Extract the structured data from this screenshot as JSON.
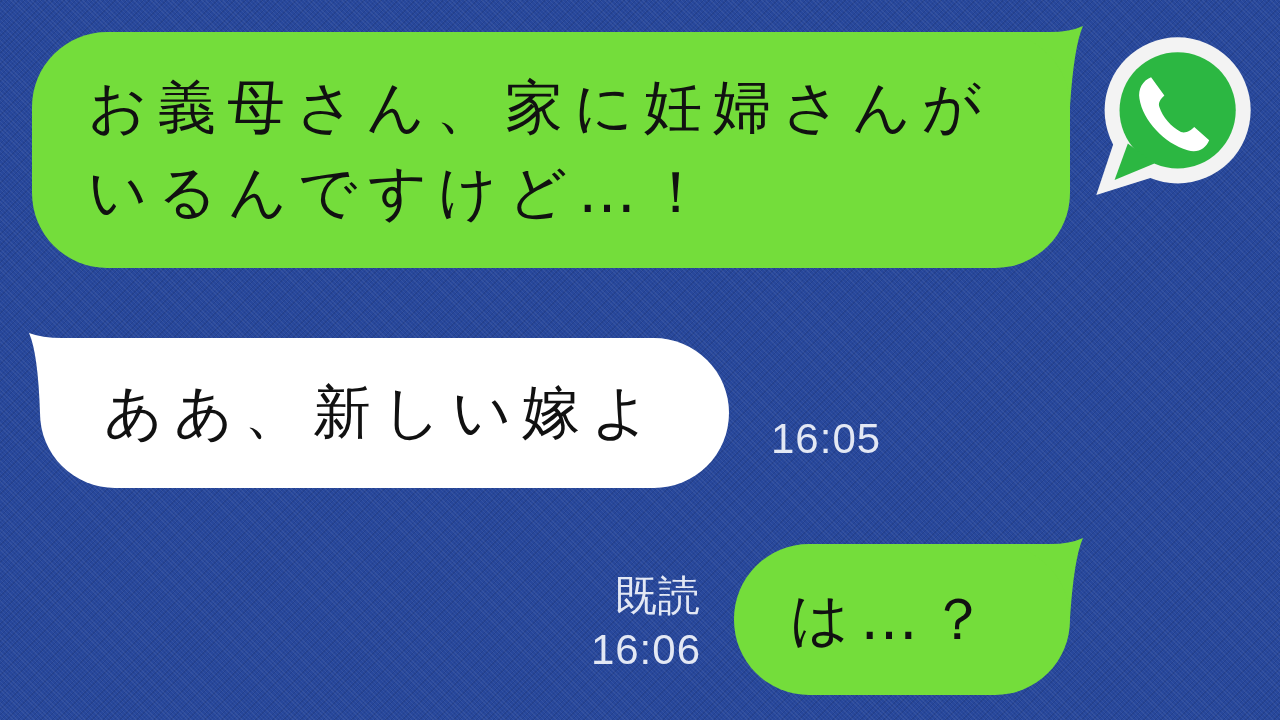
{
  "messages": [
    {
      "kind": "sent",
      "text": "お義母さん、家に妊婦さんがいるんですけど…！"
    },
    {
      "kind": "received",
      "text": "ああ、新しい嫁よ",
      "time": "16:05"
    },
    {
      "kind": "sent",
      "text": "は…？",
      "read_label": "既読",
      "time": "16:06"
    }
  ]
}
